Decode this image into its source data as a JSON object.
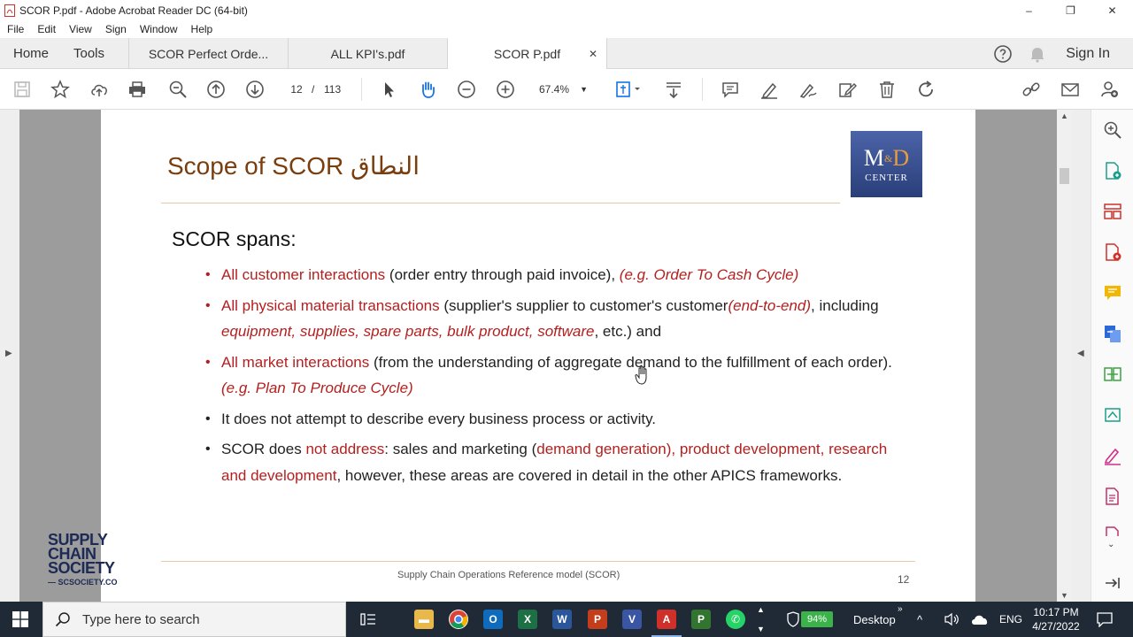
{
  "window": {
    "title": "SCOR P.pdf - Adobe Acrobat Reader DC (64-bit)",
    "controls": [
      "–",
      "❐",
      "✕"
    ]
  },
  "menu": [
    "File",
    "Edit",
    "View",
    "Sign",
    "Window",
    "Help"
  ],
  "tabs": {
    "home": "Home",
    "tools": "Tools",
    "documents": [
      {
        "label": "SCOR Perfect Orde..."
      },
      {
        "label": "ALL KPI's.pdf"
      },
      {
        "label": "SCOR P.pdf"
      }
    ],
    "close": "✕",
    "sign_in": "Sign In"
  },
  "toolbar": {
    "current_page": "12",
    "separator": "/",
    "total_pages": "113",
    "zoom": "67.4%"
  },
  "slide": {
    "title": "Scope of SCOR النطاق",
    "logo_top": "M",
    "logo_amp": "&",
    "logo_d": "D",
    "logo_bottom": "CENTER",
    "heading": "SCOR spans:",
    "b1": {
      "red": "All customer interactions",
      "text": " (order entry through paid invoice), ",
      "italic": "(e.g. Order To Cash Cycle)"
    },
    "b2": {
      "red": "All physical material transactions",
      "text1": " (supplier's supplier to customer's customer",
      "italic1": "(end-to-end)",
      "text2": ", including ",
      "italic2": "equipment, supplies, spare parts, bulk product, software",
      "text3": ", etc.) and"
    },
    "b3": {
      "red": "All market interactions",
      "text": " (from the understanding of aggregate demand to the fulfillment of each order). ",
      "italic": "(e.g. Plan To Produce Cycle)"
    },
    "b4": {
      "text": "It does not attempt to describe every business process or activity."
    },
    "b5": {
      "text1": "SCOR does ",
      "red1": "not address",
      "text2": ": sales and marketing (",
      "red2": "demand generation), product development, research and development",
      "text3": ", however, these areas are covered in detail in the other APICS frameworks."
    },
    "footer": "Supply Chain Operations Reference model (SCOR)",
    "page_number": "12"
  },
  "watermark": {
    "line1": "SUPPLY",
    "line2": "CHAIN",
    "line3": "SOCIETY",
    "site": "— SCSOCIETY.CO"
  },
  "taskbar": {
    "search_placeholder": "Type here to search",
    "battery": "94%",
    "desktop": "Desktop",
    "lang": "ENG",
    "time": "10:17 PM",
    "date": "4/27/2022"
  },
  "colors": {
    "title_brown": "#7a3e0e",
    "highlight_red": "#b42020",
    "toolbar_blue": "#1473e6",
    "taskbar": "#1f2a36"
  }
}
